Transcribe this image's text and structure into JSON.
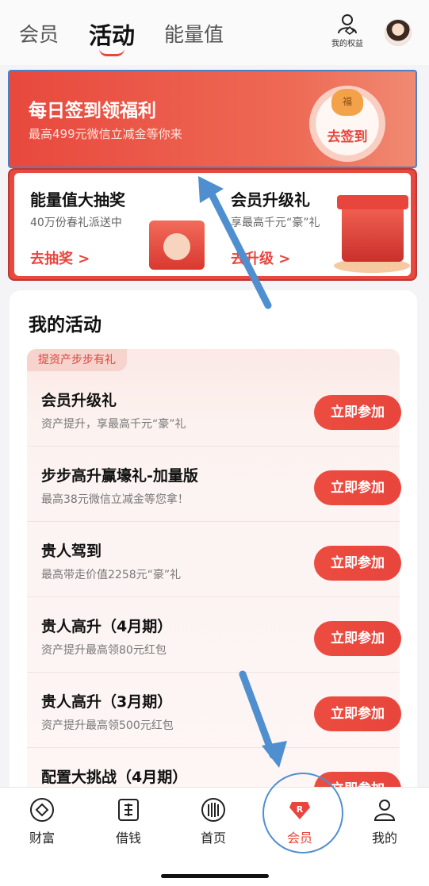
{
  "header": {
    "tabs": [
      {
        "label": "会员"
      },
      {
        "label": "活动"
      },
      {
        "label": "能量值"
      }
    ],
    "rights_label": "我的权益"
  },
  "signin_banner": {
    "title": "每日签到领福利",
    "subtitle": "最高499元微信立减金等你来",
    "bag_char": "福",
    "button_label": "去签到"
  },
  "promos": [
    {
      "title": "能量值大抽奖",
      "subtitle": "40万份春礼派送中",
      "link": "去抽奖 >"
    },
    {
      "title": "会员升级礼",
      "subtitle": "享最高千元“豪”礼",
      "link": "去升级 >"
    }
  ],
  "activities": {
    "title": "我的活动",
    "tag": "提资产步步有礼",
    "items": [
      {
        "title": "会员升级礼",
        "subtitle": "资产提升，享最高千元“豪”礼",
        "button": "立即参加"
      },
      {
        "title": "步步高升赢壕礼-加量版",
        "subtitle": "最高38元微信立减金等您拿！",
        "button": "立即参加"
      },
      {
        "title": "贵人驾到",
        "subtitle": "最高带走价值2258元“豪”礼",
        "button": "立即参加"
      },
      {
        "title": "贵人高升（4月期）",
        "subtitle": "资产提升最高领80元红包",
        "button": "立即参加"
      },
      {
        "title": "贵人高升（3月期）",
        "subtitle": "资产提升最高领500元红包",
        "button": "立即参加"
      },
      {
        "title": "配置大挑战（4月期）",
        "subtitle": "",
        "button": "立即参加"
      }
    ]
  },
  "bottom_nav": [
    {
      "label": "财富",
      "icon": "wealth-icon"
    },
    {
      "label": "借钱",
      "icon": "borrow-icon"
    },
    {
      "label": "首页",
      "icon": "home-icon"
    },
    {
      "label": "会员",
      "icon": "member-icon"
    },
    {
      "label": "我的",
      "icon": "profile-icon"
    }
  ],
  "colors": {
    "accent": "#e8453c",
    "annotation": "#4f8fd0"
  }
}
